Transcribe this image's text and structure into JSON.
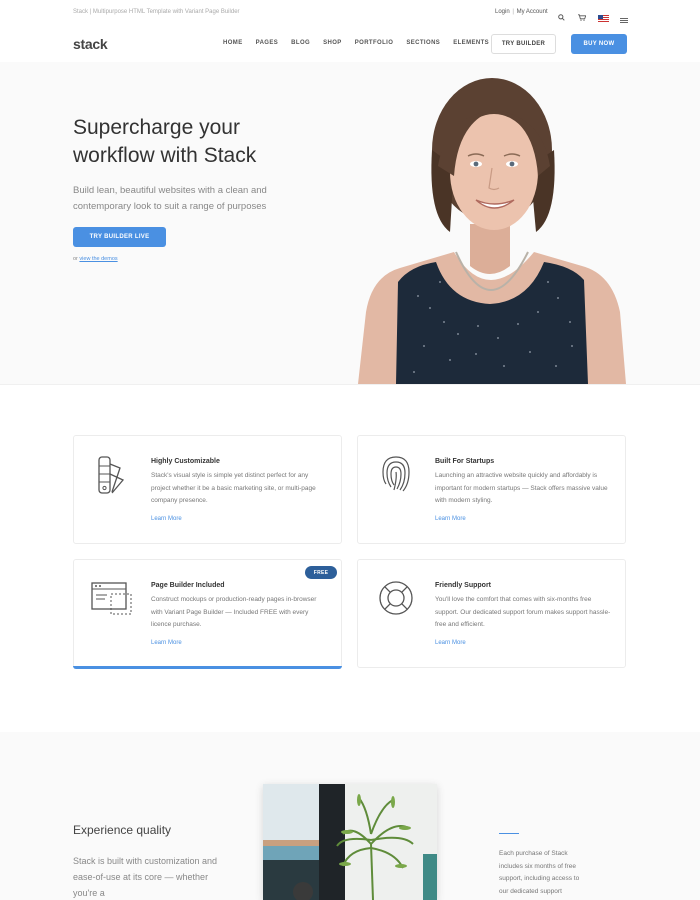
{
  "utility": {
    "note": "Stack | Multipurpose HTML Template with Variant Page Builder",
    "login": "Login",
    "my_account": "My Account"
  },
  "nav": {
    "logo": "stack",
    "items": [
      "HOME",
      "PAGES",
      "BLOG",
      "SHOP",
      "PORTFOLIO",
      "SECTIONS",
      "ELEMENTS"
    ],
    "try_builder": "TRY BUILDER",
    "buy_now": "BUY NOW"
  },
  "hero": {
    "title": "Supercharge your workflow with Stack",
    "lead": "Build lean, beautiful websites with a clean and contemporary look to suit a range of purposes",
    "cta": "TRY BUILDER LIVE",
    "demos_prefix": "or",
    "demos_link": "view the demos"
  },
  "features": [
    {
      "title": "Highly Customizable",
      "text": "Stack's visual style is simple yet distinct perfect for any project whether it be a basic marketing site, or multi-page company presence.",
      "link": "Learn More",
      "icon": "swatch-book-icon"
    },
    {
      "title": "Built For Startups",
      "text": "Launching an attractive website quickly and affordably is important for modern startups — Stack offers massive value with modern styling.",
      "link": "Learn More",
      "icon": "fingerprint-icon"
    },
    {
      "title": "Page Builder Included",
      "text": "Construct mockups or production-ready pages in-browser with Variant Page Builder — Included FREE with every licence purchase.",
      "link": "Learn More",
      "icon": "browser-window-icon",
      "badge": "FREE"
    },
    {
      "title": "Friendly Support",
      "text": "You'll love the comfort that comes with six-months free support. Our dedicated support forum makes support hassle-free and efficient.",
      "link": "Learn More",
      "icon": "lifebuoy-icon"
    }
  ],
  "quality": {
    "title": "Experience quality",
    "text": "Stack is built with customization and ease-of-use at its core — whether you're a",
    "side": "Each purchase of Stack includes six months of free support, including access to our dedicated support"
  },
  "colors": {
    "accent": "#4a90e2",
    "badge": "#2d5f9a",
    "heading": "#333333",
    "body": "#777777"
  }
}
